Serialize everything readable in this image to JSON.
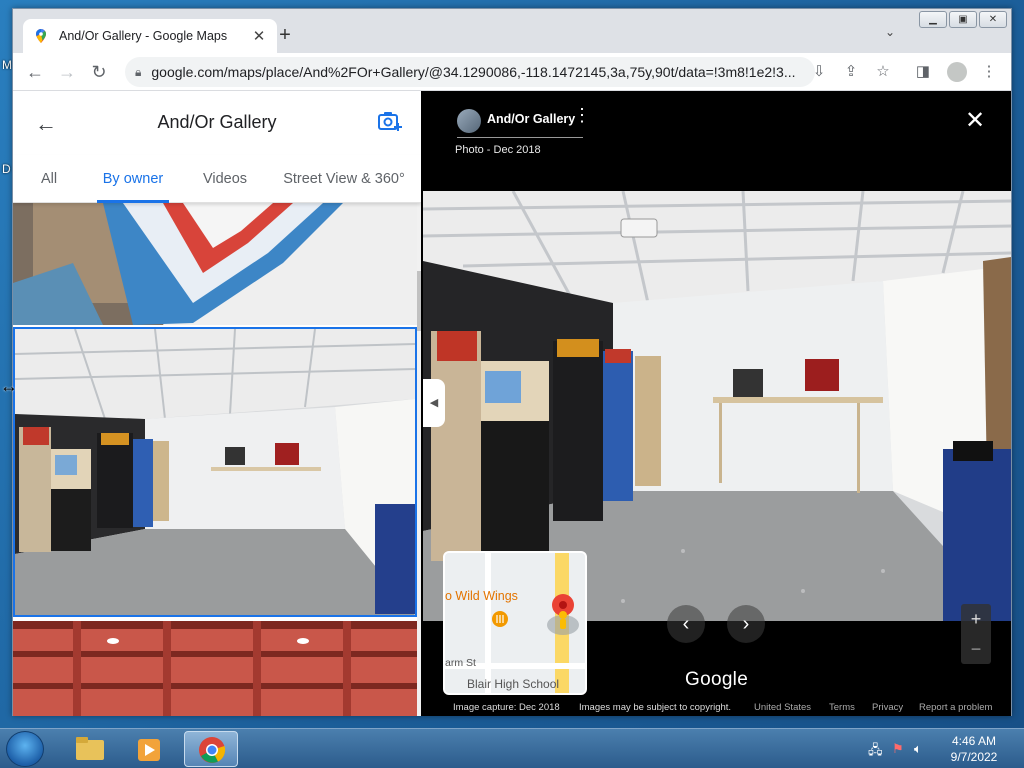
{
  "browser": {
    "tab_title": "And/Or Gallery - Google Maps",
    "tab_close": "✕",
    "new_tab": "+",
    "url": "google.com/maps/place/And%2FOr+Gallery/@34.1290086,-118.1472145,3a,75y,90t/data=!3m8!1e2!3..."
  },
  "panel": {
    "title": "And/Or Gallery",
    "tabs": [
      {
        "label": "All"
      },
      {
        "label": "By owner"
      },
      {
        "label": "Videos"
      },
      {
        "label": "Street View & 360°"
      }
    ],
    "active_tab": "By owner",
    "accent": "#1a73e8"
  },
  "viewer": {
    "owner_name": "And/Or Gallery",
    "photo_date": "Photo - Dec 2018",
    "minimap": {
      "place_label": "o Wild Wings",
      "street_label": "arm St",
      "school_label": "Blair High School"
    },
    "google_logo": "Google",
    "footer": {
      "capture": "Image capture: Dec 2018",
      "copyright": "Images may be subject to copyright.",
      "country": "United States",
      "terms": "Terms",
      "privacy": "Privacy",
      "report": "Report a problem"
    }
  },
  "taskbar": {
    "time": "4:46 AM",
    "date": "9/7/2022"
  },
  "desktop": {
    "icon_letter_1": "M",
    "icon_letter_2": "D"
  }
}
